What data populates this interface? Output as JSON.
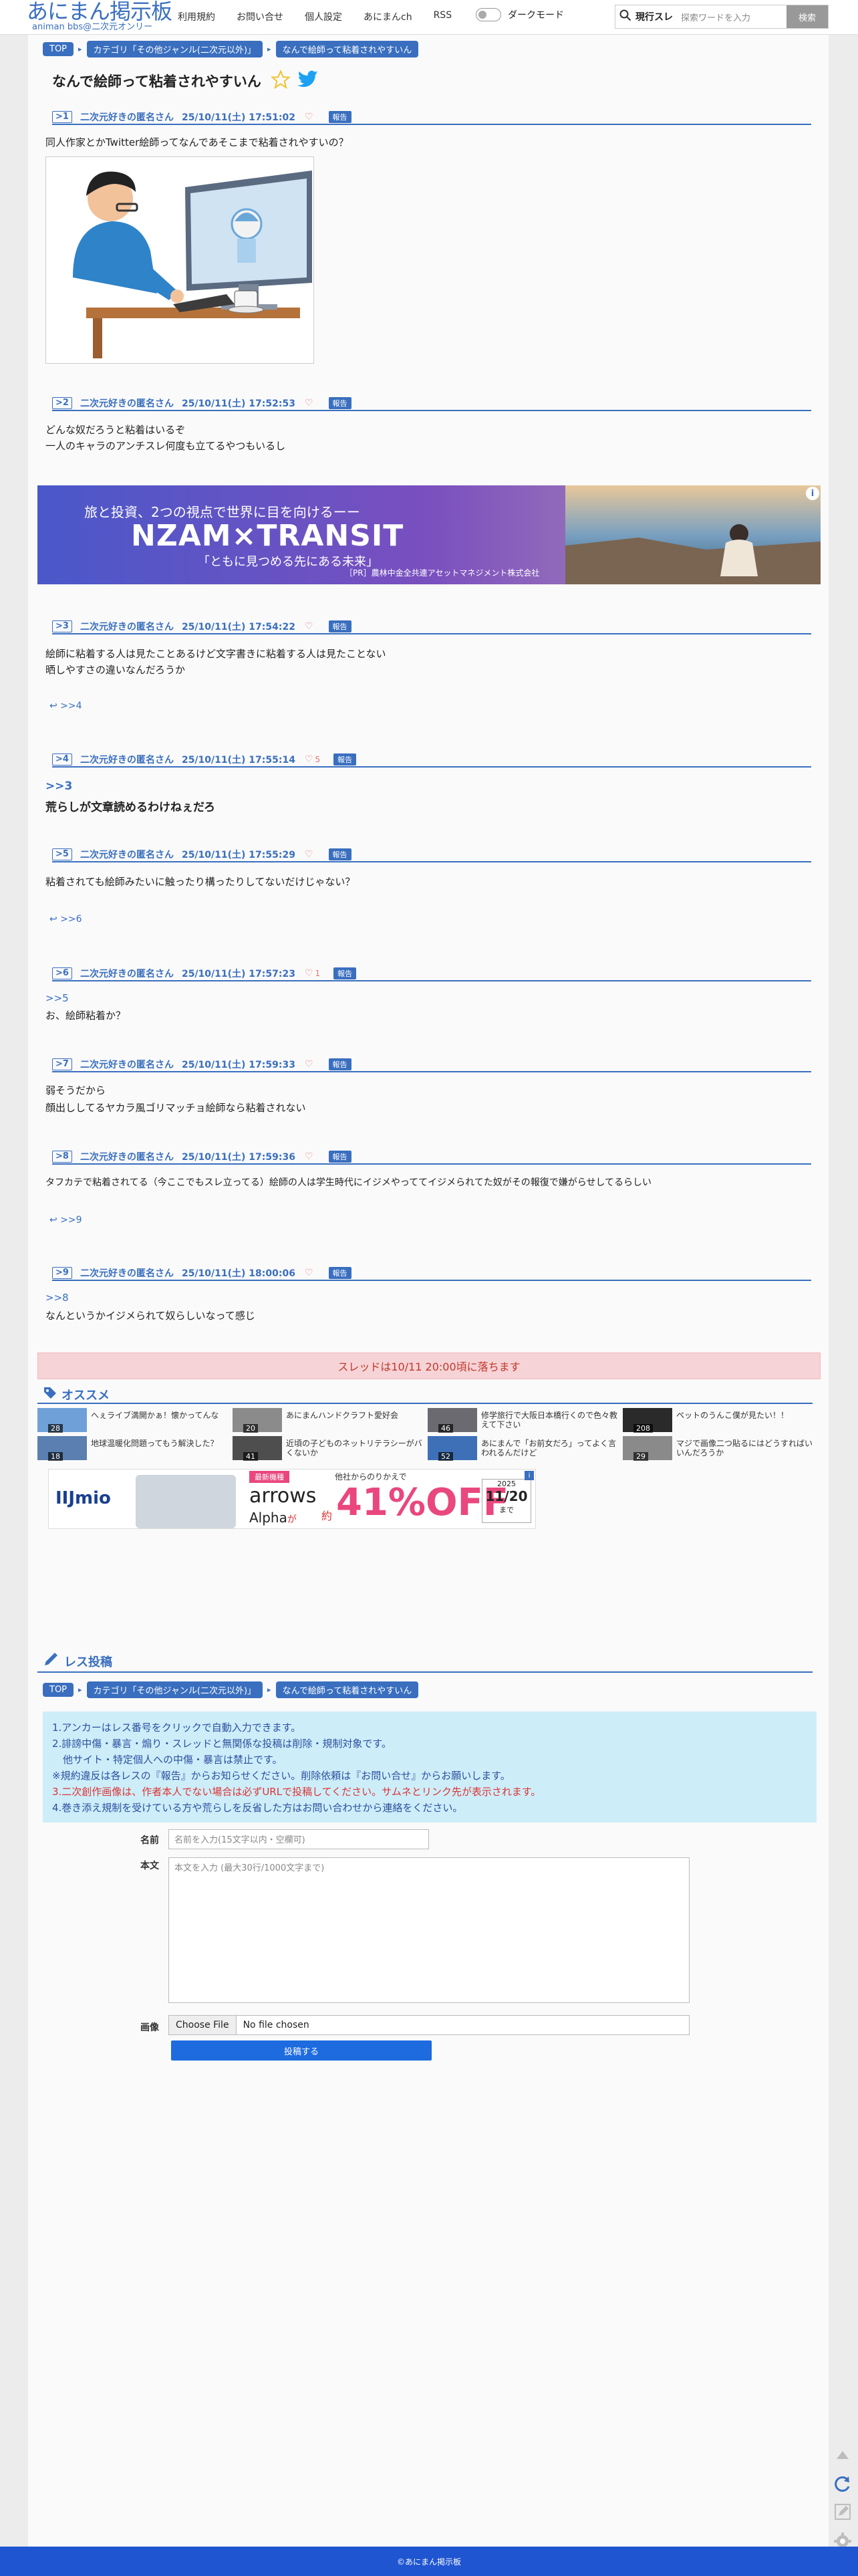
{
  "header": {
    "logo_main": "あにまん掲示板",
    "logo_sub": "animan bbs@二次元オンリー",
    "nav": [
      "利用規約",
      "お問い合せ",
      "個人設定",
      "あにまんch",
      "RSS"
    ],
    "dark_mode": "ダークモード",
    "search_current": "現行スレ",
    "search_placeholder": "探索ワードを入力",
    "search_button": "検索"
  },
  "breadcrumb": [
    "TOP",
    "カテゴリ「その他ジャンル(二次元以外)」",
    "なんで絵師って粘着されやすいん"
  ],
  "thread_title": "なんで絵師って粘着されやすいん",
  "report_label": "報告",
  "posts": [
    {
      "num": "1",
      "name": "二次元好きの匿名さん",
      "date": "25/10/11(土) 17:51:02",
      "likes": "",
      "lines": [
        "同人作家とかTwitter絵師ってなんであそこまで粘着されやすいの？"
      ]
    },
    {
      "num": "2",
      "name": "二次元好きの匿名さん",
      "date": "25/10/11(土) 17:52:53",
      "likes": "",
      "lines": [
        "どんな奴だろうと粘着はいるぞ",
        "一人のキャラのアンチスレ何度も立てるやつもいるし"
      ]
    },
    {
      "num": "3",
      "name": "二次元好きの匿名さん",
      "date": "25/10/11(土) 17:54:22",
      "likes": "",
      "lines": [
        "絵師に粘着する人は見たことあるけど文字書きに粘着する人は見たことない",
        "晒しやすさの違いなんだろうか"
      ],
      "reply": ">>4"
    },
    {
      "num": "4",
      "name": "二次元好きの匿名さん",
      "date": "25/10/11(土) 17:55:14",
      "likes": "5",
      "anchor": ">>3",
      "lines": [
        "荒らしが文章読めるわけねぇだろ"
      ]
    },
    {
      "num": "5",
      "name": "二次元好きの匿名さん",
      "date": "25/10/11(土) 17:55:29",
      "likes": "",
      "lines": [
        "粘着されても絵師みたいに触ったり構ったりしてないだけじゃない？"
      ],
      "reply": ">>6"
    },
    {
      "num": "6",
      "name": "二次元好きの匿名さん",
      "date": "25/10/11(土) 17:57:23",
      "likes": "1",
      "anchor": ">>5",
      "lines": [
        "お、絵師粘着か？"
      ]
    },
    {
      "num": "7",
      "name": "二次元好きの匿名さん",
      "date": "25/10/11(土) 17:59:33",
      "likes": "",
      "lines": [
        "弱そうだから",
        "顔出ししてるヤカラ風ゴリマッチョ絵師なら粘着されない"
      ]
    },
    {
      "num": "8",
      "name": "二次元好きの匿名さん",
      "date": "25/10/11(土) 17:59:36",
      "likes": "",
      "lines": [
        "タフカテで粘着されてる（今ここでもスレ立ってる）絵師の人は学生時代にイジメやっててイジメられてた奴がその報復で嫌がらせしてるらしい"
      ],
      "reply": ">>9"
    },
    {
      "num": "9",
      "name": "二次元好きの匿名さん",
      "date": "25/10/11(土) 18:00:06",
      "likes": "",
      "anchor": ">>8",
      "lines": [
        "なんというかイジメられて奴らしいなって感じ"
      ]
    }
  ],
  "ad1": {
    "line1": "旅と投資、2つの視点で世界に目を向けるーー",
    "logo": "NZAM×TRANSIT",
    "line2": "「ともに見つめる先にある未来」",
    "sponsor": "［PR］農林中金全共連アセットマネジメント株式会社"
  },
  "expire_notice": "スレッドは10/11 20:00頃に落ちます",
  "recommend": {
    "heading": "オススメ",
    "items": [
      {
        "title": "へぇライブ満開かぁ！懐かってんな",
        "count": "28"
      },
      {
        "title": "あにまんハンドクラフト愛好会",
        "count": "20"
      },
      {
        "title": "修学旅行で大阪日本橋行くので色々教えて下さい",
        "count": "46"
      },
      {
        "title": "ペットのうんこ僕が見たい！！",
        "count": "208"
      },
      {
        "title": "地球温暖化問題ってもう解決した？",
        "count": "18"
      },
      {
        "title": "近頃の子どものネットリテラシーがバくないか",
        "count": "41"
      },
      {
        "title": "あにまんで「お前女だろ」ってよく言われるんだけど",
        "count": "52"
      },
      {
        "title": "マジで画像二つ貼るにはどうすればいいんだろうか",
        "count": "29"
      }
    ]
  },
  "ad2": {
    "brand": "IIJmio",
    "phone": "arrows",
    "model": "Alpha",
    "ga": "が",
    "tag": "最新機種",
    "note": "他社からのりかえで",
    "approx": "約",
    "discount": "41%OFF",
    "date_year": "2025",
    "date": "11/20",
    "date_suffix": "まで"
  },
  "post_form": {
    "heading": "レス投稿",
    "notice": [
      "1.アンカーはレス番号をクリックで自動入力できます。",
      "2.誹謗中傷・暴言・煽り・スレッドと無関係な投稿は削除・規制対象です。",
      "他サイト・特定個人への中傷・暴言は禁止です。",
      "※規約違反は各レスの『報告』からお知らせください。削除依頼は『お問い合せ』からお願いします。",
      "3.二次創作画像は、作者本人でない場合は必ずURLで投稿してください。サムネとリンク先が表示されます。",
      "4.巻き添え規制を受けている方や荒らしを反省した方はお問い合わせから連絡をください。"
    ],
    "name_label": "名前",
    "name_placeholder": "名前を入力(15文字以内・空欄可)",
    "body_label": "本文",
    "body_placeholder": "本文を入力 (最大30行/1000文字まで)",
    "image_label": "画像",
    "choose_file": "Choose File",
    "no_file": "No file chosen",
    "submit": "投稿する"
  },
  "footer": "©あにまん掲示板",
  "colors": {
    "accent": "#3a6fbf",
    "footer": "#1f55d1",
    "submit": "#1e6be0",
    "heart": "#e57373"
  }
}
